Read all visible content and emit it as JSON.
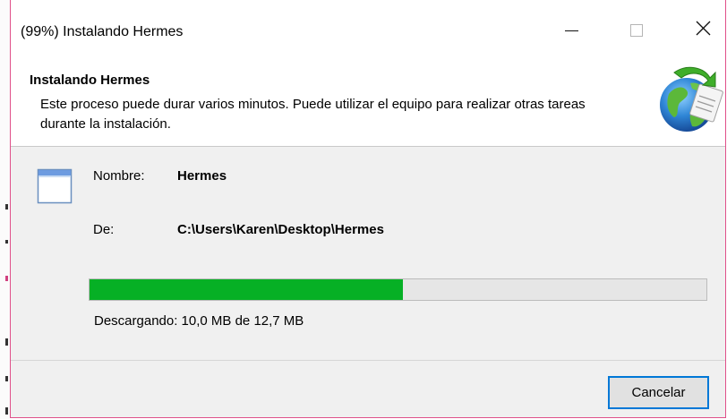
{
  "window": {
    "title": "(99%) Instalando Hermes"
  },
  "header": {
    "title": "Instalando Hermes",
    "description": "Este proceso puede durar varios minutos. Puede utilizar el equipo para realizar otras tareas durante la instalación."
  },
  "details": {
    "name_label": "Nombre:",
    "name_value": "Hermes",
    "from_label": "De:",
    "from_value": "C:\\Users\\Karen\\Desktop\\Hermes"
  },
  "progress": {
    "fraction": 0.508,
    "status": "Descargando: 10,0 MB de 12,7 MB",
    "fill_color": "#06b025"
  },
  "buttons": {
    "cancel": "Cancelar"
  },
  "icons": {
    "header": "globe-installer-icon",
    "application": "window-app-icon",
    "minimize": "minimize-icon",
    "maximize": "maximize-icon",
    "close": "close-icon"
  },
  "colors": {
    "accent": "#0078d7",
    "window_border": "#e0508a"
  }
}
